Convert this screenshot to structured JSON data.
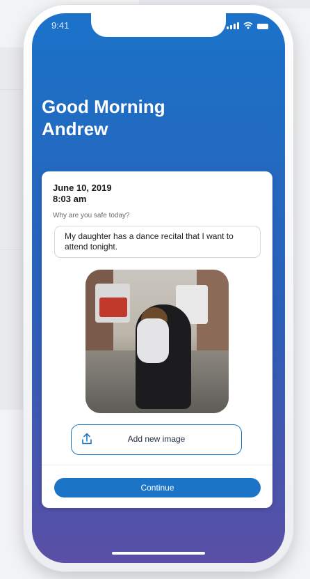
{
  "status": {
    "time": "9:41"
  },
  "greeting": {
    "line1": "Good Morning",
    "line2": "Andrew"
  },
  "entry": {
    "date": "June 10, 2019",
    "time": "8:03 am",
    "question": "Why are you safe today?",
    "answer": "My daughter has a dance recital that I want to attend tonight."
  },
  "actions": {
    "add_image_label": "Add new image",
    "continue_label": "Continue"
  },
  "colors": {
    "accent": "#1b74c6",
    "gradient_top": "#1b73c9",
    "gradient_bottom": "#5a4fa6"
  }
}
